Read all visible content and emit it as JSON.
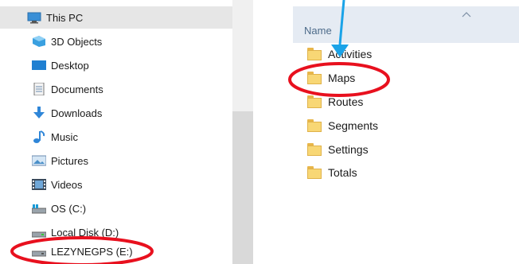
{
  "navigation": {
    "items": [
      {
        "label": "This PC",
        "icon": "computer-icon",
        "selected": true
      },
      {
        "label": "3D Objects",
        "icon": "3d-objects-icon"
      },
      {
        "label": "Desktop",
        "icon": "desktop-icon"
      },
      {
        "label": "Documents",
        "icon": "documents-icon"
      },
      {
        "label": "Downloads",
        "icon": "downloads-icon"
      },
      {
        "label": "Music",
        "icon": "music-icon"
      },
      {
        "label": "Pictures",
        "icon": "pictures-icon"
      },
      {
        "label": "Videos",
        "icon": "videos-icon"
      },
      {
        "label": "OS (C:)",
        "icon": "os-drive-icon"
      },
      {
        "label": "Local Disk (D:)",
        "icon": "disk-drive-icon"
      },
      {
        "label": "LEZYNEGPS (E:)",
        "icon": "usb-drive-icon"
      }
    ]
  },
  "file_list": {
    "header": {
      "name_label": "Name",
      "sort_icon": "sort-ascending-icon"
    },
    "items": [
      {
        "name": "Activities",
        "icon": "folder-icon"
      },
      {
        "name": "Maps",
        "icon": "folder-icon"
      },
      {
        "name": "Routes",
        "icon": "folder-icon"
      },
      {
        "name": "Segments",
        "icon": "folder-icon"
      },
      {
        "name": "Settings",
        "icon": "folder-icon"
      },
      {
        "name": "Totals",
        "icon": "folder-icon"
      }
    ]
  },
  "annotations": {
    "highlight_color": "#e8101e",
    "arrow_color": "#1aa3e8"
  }
}
